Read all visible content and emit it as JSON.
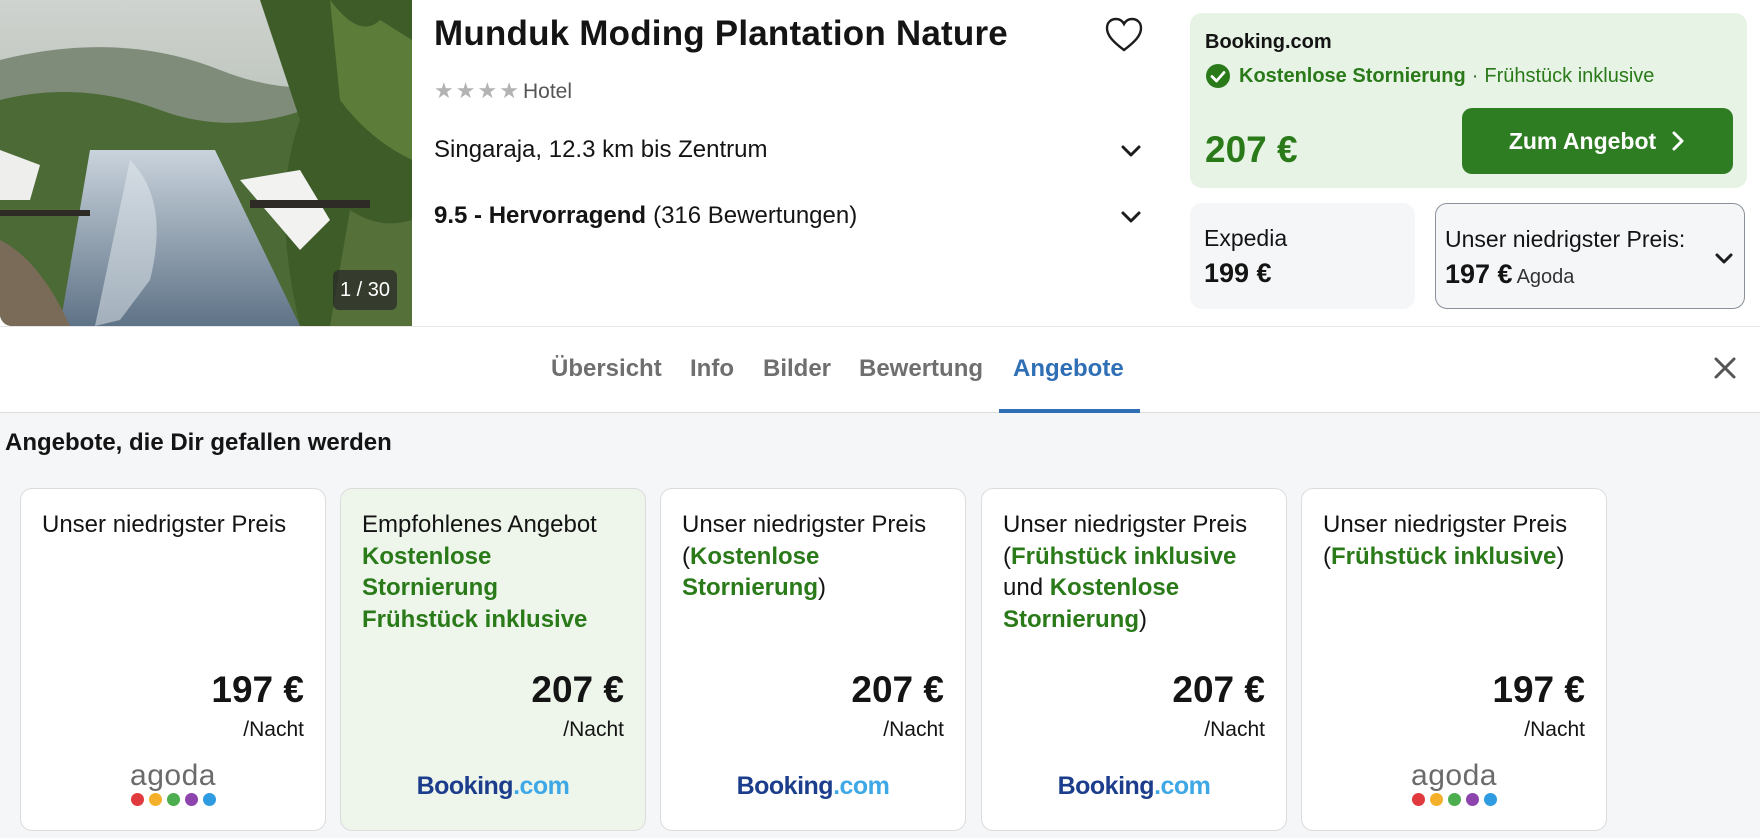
{
  "hotel": {
    "name": "Munduk Moding Plantation Nature",
    "star_count": 4,
    "type": "Hotel",
    "location": "Singaraja, 12.3 km bis Zentrum",
    "rating_score": "9.5 - Hervorragend",
    "rating_count": "(316 Bewertungen)",
    "photo_counter": "1 / 30"
  },
  "main_deal": {
    "provider": "Booking.com",
    "free_cancel": "Kostenlose Stornierung",
    "separator": "·",
    "breakfast": "Frühstück inklusive",
    "price": "207 €",
    "button_label": "Zum Angebot"
  },
  "alt_deals": {
    "expedia": {
      "name": "Expedia",
      "price": "199 €"
    },
    "lowest": {
      "label": "Unser niedrigster Preis:",
      "price": "197 €",
      "provider": "Agoda"
    }
  },
  "tabs": [
    {
      "label": "Übersicht"
    },
    {
      "label": "Info"
    },
    {
      "label": "Bilder"
    },
    {
      "label": "Bewertung"
    },
    {
      "label": "Angebote"
    }
  ],
  "active_tab": "Angebote",
  "offers": {
    "title": "Angebote, die Dir gefallen werden",
    "per_night": "/Nacht",
    "cards": [
      {
        "line1": "Unser niedrigster Preis",
        "price": "197 €",
        "provider": "agoda"
      },
      {
        "line1": "Empfohlenes Angebot",
        "green1": "Kostenlose Stornierung",
        "green2": "Frühstück inklusive",
        "price": "207 €",
        "provider": "Booking.com"
      },
      {
        "line1": "Unser niedrigster Preis",
        "open": "(",
        "green1": "Kostenlose Stornierung",
        "close": ")",
        "price": "207 €",
        "provider": "Booking.com"
      },
      {
        "line1": "Unser niedrigster Preis",
        "open": "(",
        "green1": "Frühstück inklusive",
        "and": "und",
        "green2": "Kostenlose Stornierung",
        "close": ")",
        "price": "207 €",
        "provider": "Booking.com"
      },
      {
        "line1": "Unser niedrigster Preis",
        "open": "(",
        "green1": "Frühstück inklusive",
        "close": ")",
        "price": "197 €",
        "provider": "agoda"
      }
    ]
  },
  "logos": {
    "booking_main": "Booking",
    "booking_ext": ".com",
    "agoda": "agoda"
  },
  "colors": {
    "accent_green": "#2f7d22",
    "deal_bg": "#e7f3e5",
    "tab_active": "#2e6fb5",
    "booking_dark": "#1b3d8c",
    "booking_light": "#3ea8e6",
    "agoda_dots": [
      "#e03a3e",
      "#f4b02a",
      "#4cae4f",
      "#8e44ad",
      "#2f9be0"
    ]
  }
}
